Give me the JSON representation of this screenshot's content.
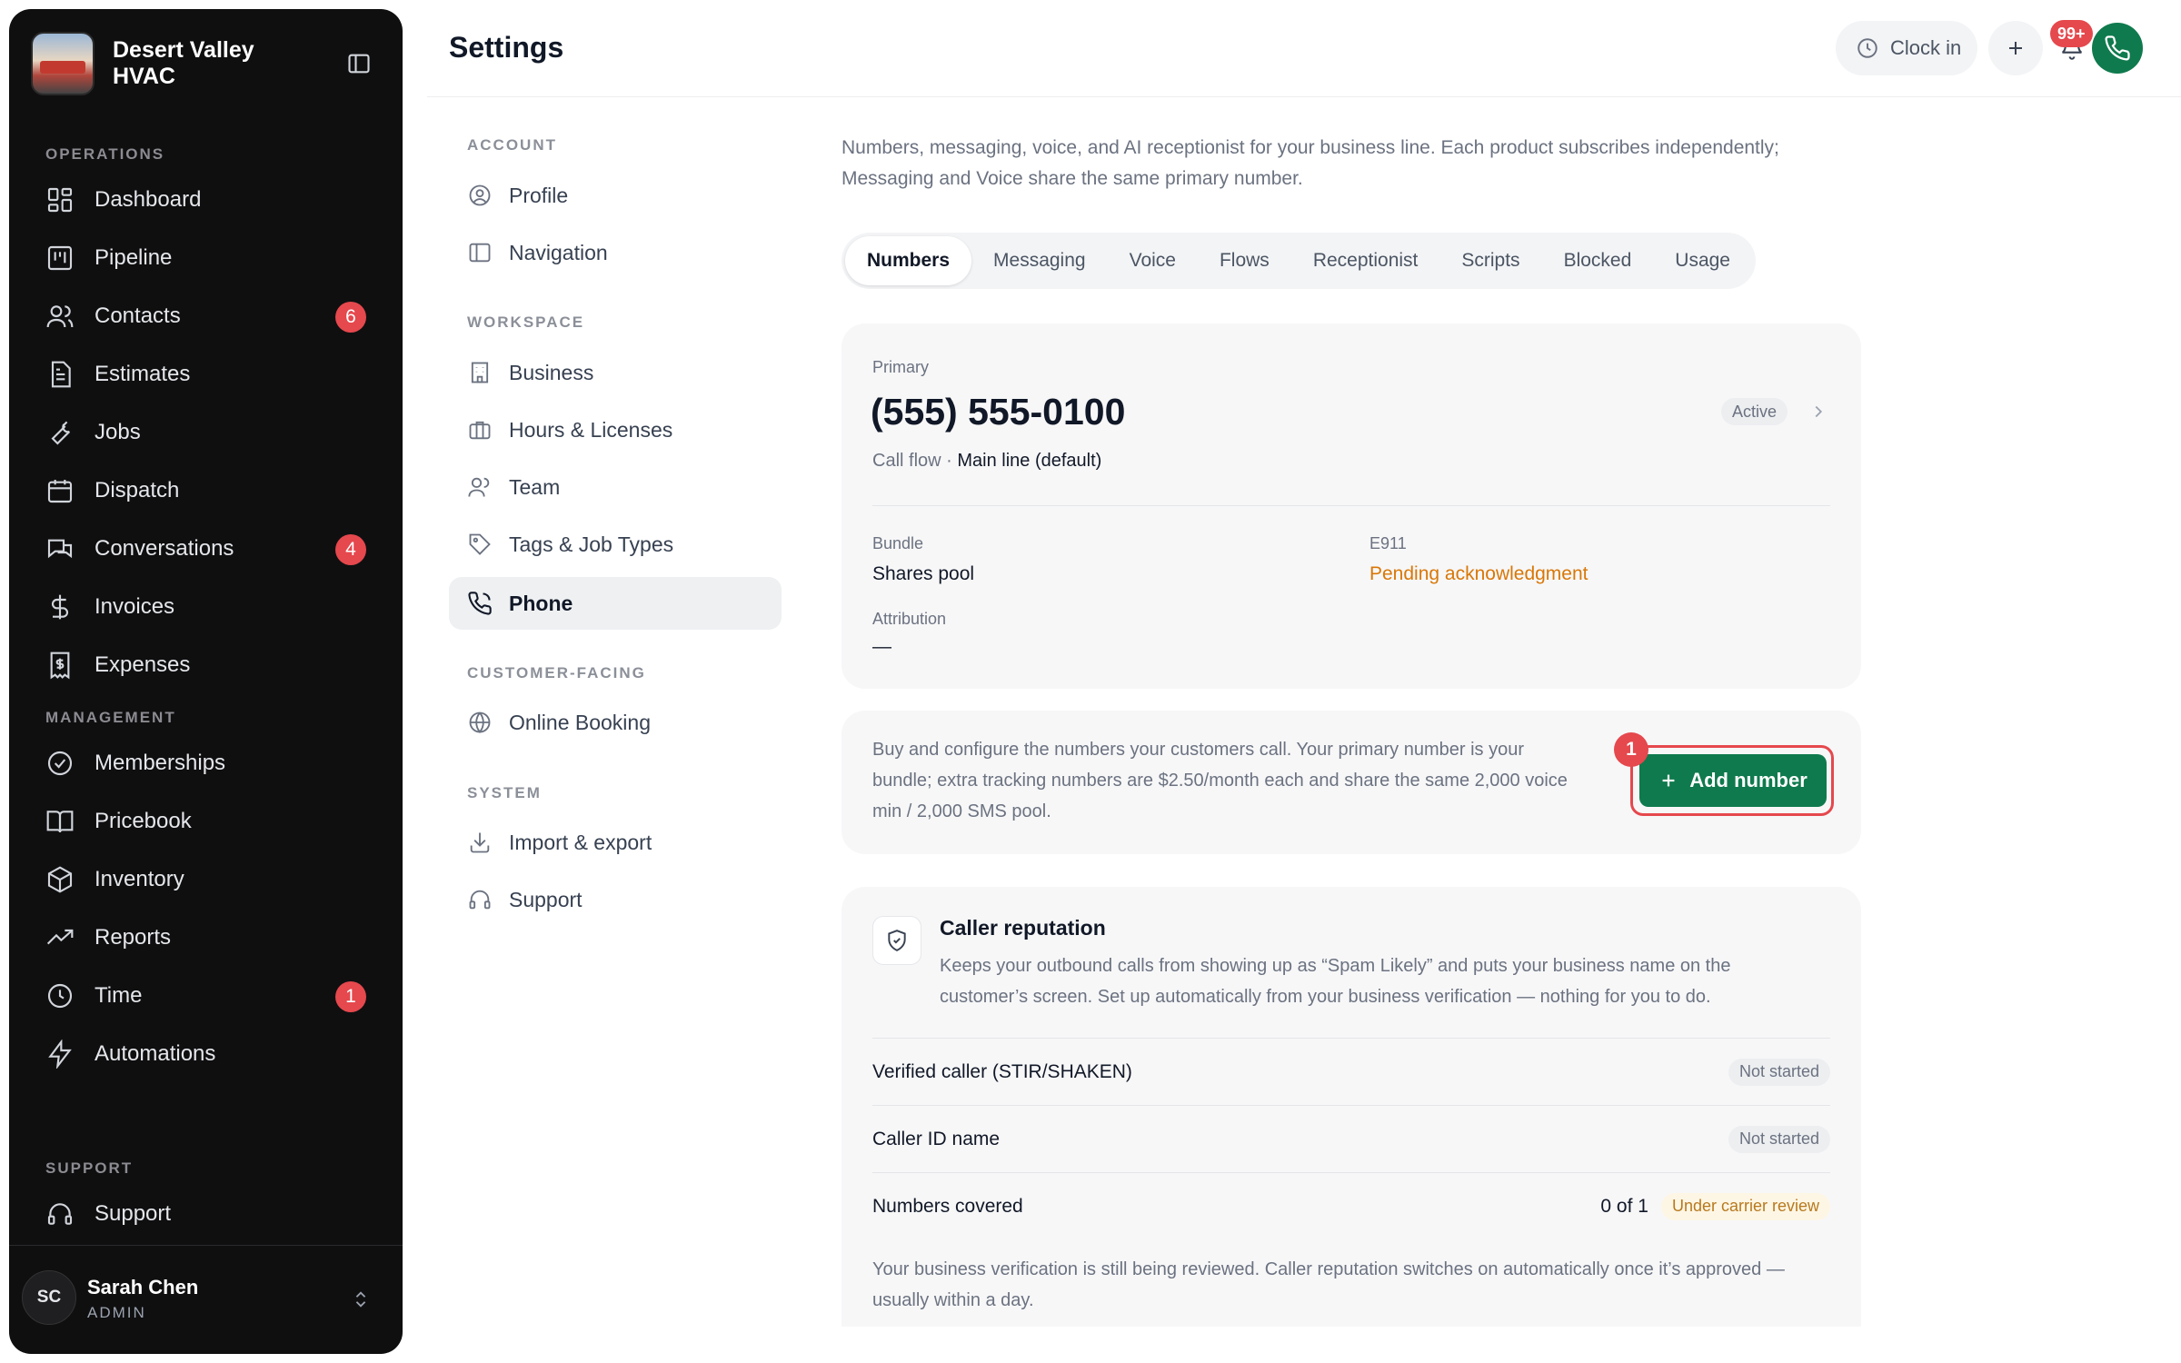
{
  "brand": {
    "name": "Desert Valley HVAC"
  },
  "sidebar": {
    "sections": {
      "operations": "OPERATIONS",
      "management": "MANAGEMENT",
      "support": "SUPPORT"
    },
    "items": [
      {
        "label": "Dashboard",
        "icon": "dashboard-icon"
      },
      {
        "label": "Pipeline",
        "icon": "pipeline-icon"
      },
      {
        "label": "Contacts",
        "icon": "contacts-icon",
        "badge": "6"
      },
      {
        "label": "Estimates",
        "icon": "estimates-icon"
      },
      {
        "label": "Jobs",
        "icon": "wrench-icon"
      },
      {
        "label": "Dispatch",
        "icon": "calendar-icon"
      },
      {
        "label": "Conversations",
        "icon": "chat-icon",
        "badge": "4"
      },
      {
        "label": "Invoices",
        "icon": "dollar-icon"
      },
      {
        "label": "Expenses",
        "icon": "receipt-icon"
      },
      {
        "label": "Memberships",
        "icon": "badge-check-icon"
      },
      {
        "label": "Pricebook",
        "icon": "book-icon"
      },
      {
        "label": "Inventory",
        "icon": "box-icon"
      },
      {
        "label": "Reports",
        "icon": "trend-icon"
      },
      {
        "label": "Time",
        "icon": "clock-icon",
        "badge": "1"
      },
      {
        "label": "Automations",
        "icon": "bolt-icon"
      },
      {
        "label": "Support",
        "icon": "headset-icon"
      }
    ],
    "user": {
      "initials": "SC",
      "name": "Sarah Chen",
      "role": "ADMIN"
    }
  },
  "header": {
    "title": "Settings",
    "clock_in": "Clock in",
    "notifications_badge": "99+"
  },
  "settings_nav": {
    "sections": {
      "account": "ACCOUNT",
      "workspace": "WORKSPACE",
      "customer_facing": "CUSTOMER-FACING",
      "system": "SYSTEM"
    },
    "items": [
      {
        "label": "Profile"
      },
      {
        "label": "Navigation"
      },
      {
        "label": "Business"
      },
      {
        "label": "Hours & Licenses"
      },
      {
        "label": "Team"
      },
      {
        "label": "Tags & Job Types"
      },
      {
        "label": "Phone",
        "active": true
      },
      {
        "label": "Online Booking"
      },
      {
        "label": "Import & export"
      },
      {
        "label": "Support"
      }
    ]
  },
  "main": {
    "intro": "Numbers, messaging, voice, and AI receptionist for your business line. Each product subscribes independently; Messaging and Voice share the same primary number.",
    "tabs": [
      "Numbers",
      "Messaging",
      "Voice",
      "Flows",
      "Receptionist",
      "Scripts",
      "Blocked",
      "Usage"
    ],
    "active_tab": "Numbers",
    "primary": {
      "label": "Primary",
      "number": "(555) 555-0100",
      "call_flow_label": "Call flow · ",
      "call_flow_value": "Main line (default)",
      "status": "Active",
      "bundle_label": "Bundle",
      "bundle_value": "Shares pool",
      "e911_label": "E911",
      "e911_value": "Pending acknowledgment",
      "attribution_label": "Attribution",
      "attribution_value": "—"
    },
    "buy": {
      "text": "Buy and configure the numbers your customers call. Your primary number is your bundle; extra tracking numbers are $2.50/month each and share the same 2,000 voice min / 2,000 SMS pool.",
      "button": "Add number",
      "step": "1"
    },
    "reputation": {
      "title": "Caller reputation",
      "description": "Keeps your outbound calls from showing up as “Spam Likely” and puts your business name on the customer’s screen. Set up automatically from your business verification — nothing for you to do.",
      "rows": [
        {
          "label": "Verified caller (STIR/SHAKEN)",
          "status": "Not started"
        },
        {
          "label": "Caller ID name",
          "status": "Not started"
        },
        {
          "label": "Numbers covered",
          "count": "0 of 1",
          "status": "Under carrier review"
        }
      ],
      "footer": "Your business verification is still being reviewed. Caller reputation switches on automatically once it’s approved — usually within a day."
    }
  },
  "colors": {
    "accent_green": "#0f7a4d",
    "badge_red": "#e5484d",
    "warning_orange": "#d97706"
  }
}
